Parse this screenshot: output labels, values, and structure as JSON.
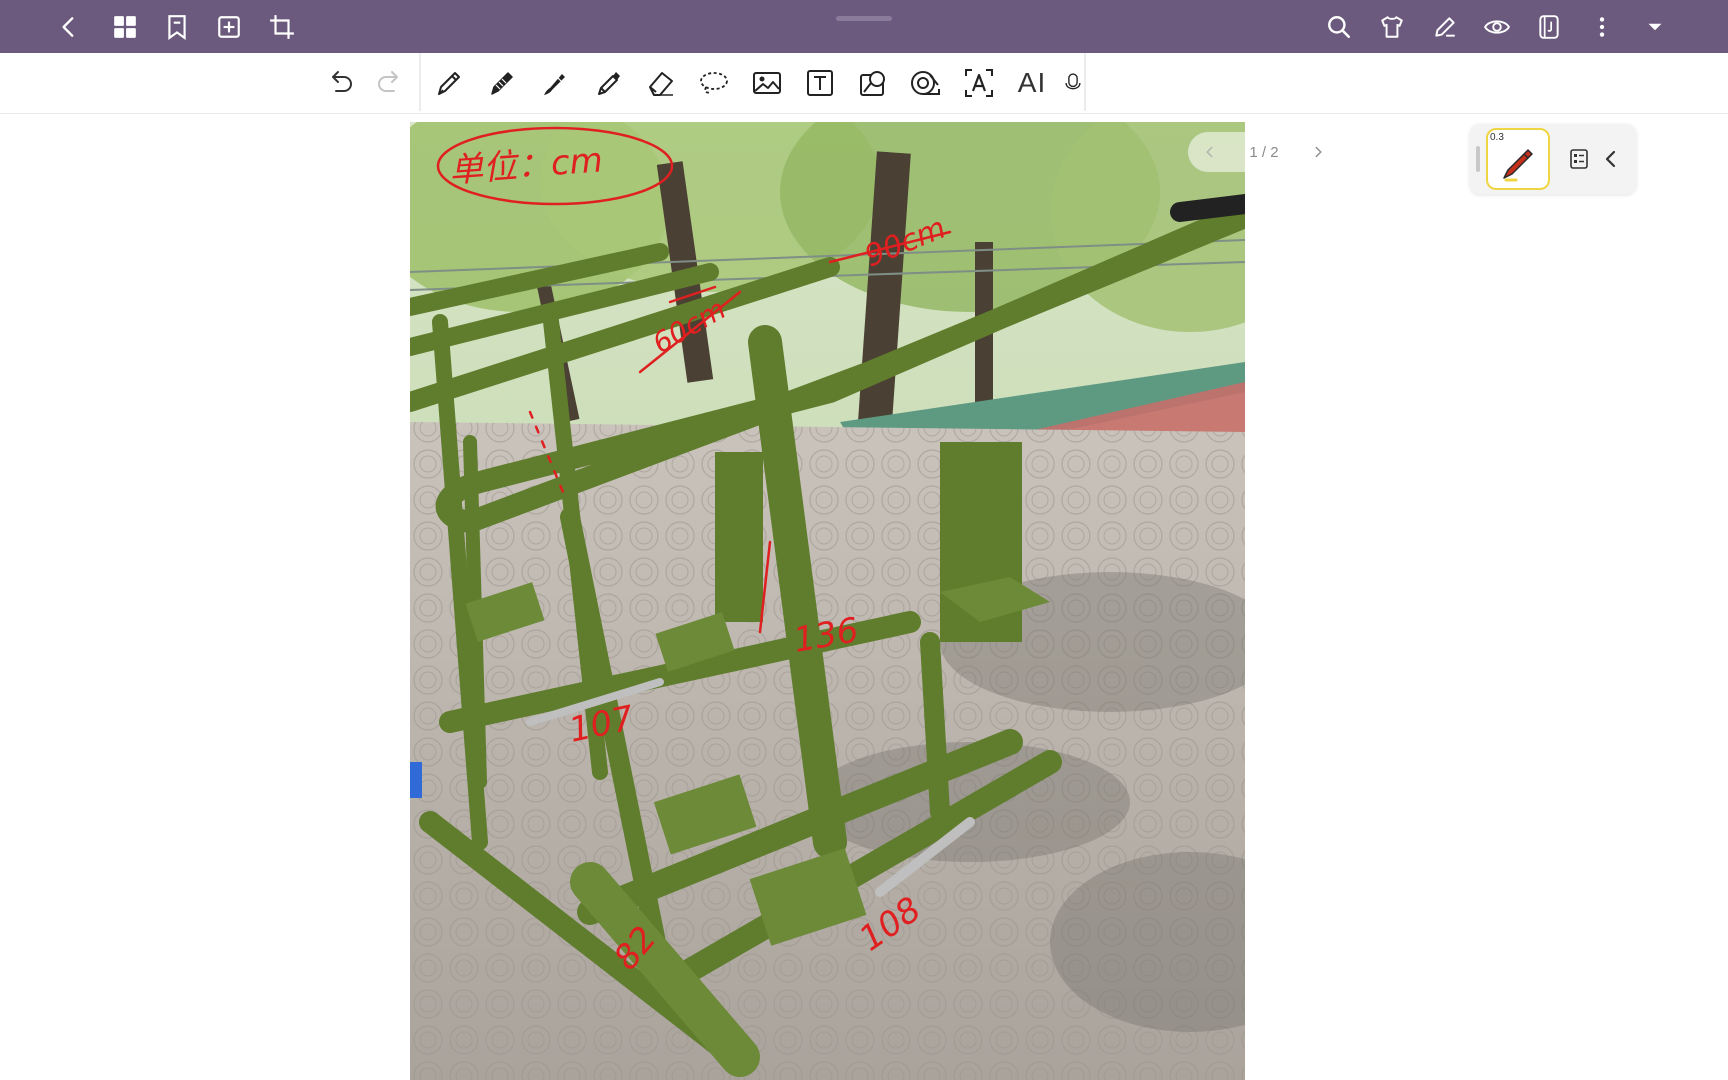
{
  "topbar": {
    "left_icons": [
      "back-arrow-icon",
      "grid-icon",
      "bookmark-icon",
      "add-page-icon",
      "crop-icon"
    ],
    "right_icons": [
      "search-icon",
      "shirt-icon",
      "pen-edit-icon",
      "eye-icon",
      "notebook-icon",
      "more-vertical-icon",
      "dropdown-icon"
    ],
    "bg_color": "#6b5a7e"
  },
  "toolbar": {
    "tools": [
      "undo-icon",
      "redo-icon",
      "fountain-pen-icon",
      "pencil-icon",
      "brush-pen-icon",
      "highlighter-icon",
      "eraser-icon",
      "lasso-icon",
      "image-icon",
      "text-box-icon",
      "shape-icon",
      "tape-icon",
      "text-recognition-icon",
      "ai-icon"
    ],
    "ai_label": "AI"
  },
  "pager": {
    "text": "1 / 2"
  },
  "palette": {
    "pen_size": "0.3",
    "pen_color": "#c4301c",
    "highlight_color": "#f0d542"
  },
  "annotations": {
    "unit_note": "单位：cm",
    "labels": [
      "90cm",
      "60cm",
      "136",
      "107",
      "108",
      "82"
    ],
    "ink_color": "#e02020"
  }
}
